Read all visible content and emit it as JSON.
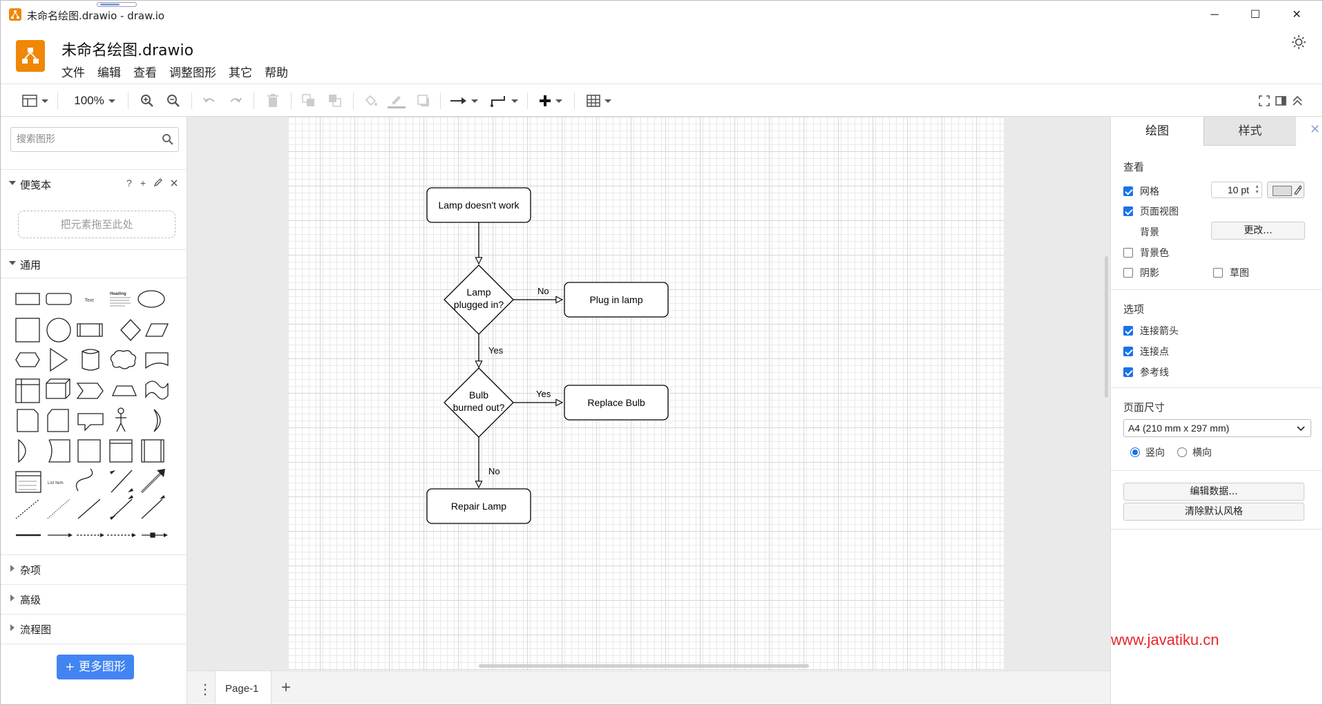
{
  "window": {
    "title": "未命名绘图.drawio - draw.io",
    "minimize": "─",
    "maximize": "☐",
    "close": "✕"
  },
  "header": {
    "doc_title": "未命名绘图.drawio",
    "menu": [
      "文件",
      "编辑",
      "查看",
      "调整图形",
      "其它",
      "帮助"
    ]
  },
  "toolbar": {
    "zoom": "100%"
  },
  "left": {
    "search_placeholder": "搜索图形",
    "scratchpad": "便笺本",
    "scratchpad_help": "?",
    "scratchpad_add": "+",
    "drop_hint": "把元素拖至此处",
    "general": "通用",
    "misc": "杂项",
    "advanced": "高级",
    "flowchart": "流程图",
    "more_shapes": "+ 更多图形",
    "shape_text": "Text",
    "shape_heading": "Heading",
    "shape_list_item": "List Item"
  },
  "diagram": {
    "start": "Lamp doesn't work",
    "decision1_line1": "Lamp",
    "decision1_line2": "plugged in?",
    "no1": "No",
    "action1": "Plug in lamp",
    "yes1": "Yes",
    "decision2_line1": "Bulb",
    "decision2_line2": "burned out?",
    "yes2": "Yes",
    "action2": "Replace Bulb",
    "no2": "No",
    "end": "Repair Lamp"
  },
  "pages": {
    "tab": "Page-1",
    "menu_icon": "⋮",
    "add": "+"
  },
  "right": {
    "tab_draw": "绘图",
    "tab_style": "样式",
    "close": "✕",
    "view_heading": "查看",
    "grid": "网格",
    "grid_size": "10 pt",
    "page_view": "页面视图",
    "background": "背景",
    "change": "更改...",
    "bg_color": "背景色",
    "shadow": "阴影",
    "sketch": "草图",
    "options_heading": "选项",
    "conn_arrows": "连接箭头",
    "conn_points": "连接点",
    "guides": "参考线",
    "page_size_heading": "页面尺寸",
    "page_size": "A4 (210 mm x 297 mm)",
    "portrait": "竖向",
    "landscape": "横向",
    "edit_data": "编辑数据...",
    "clear_style": "清除默认风格"
  },
  "watermark": "www.javatiku.cn"
}
